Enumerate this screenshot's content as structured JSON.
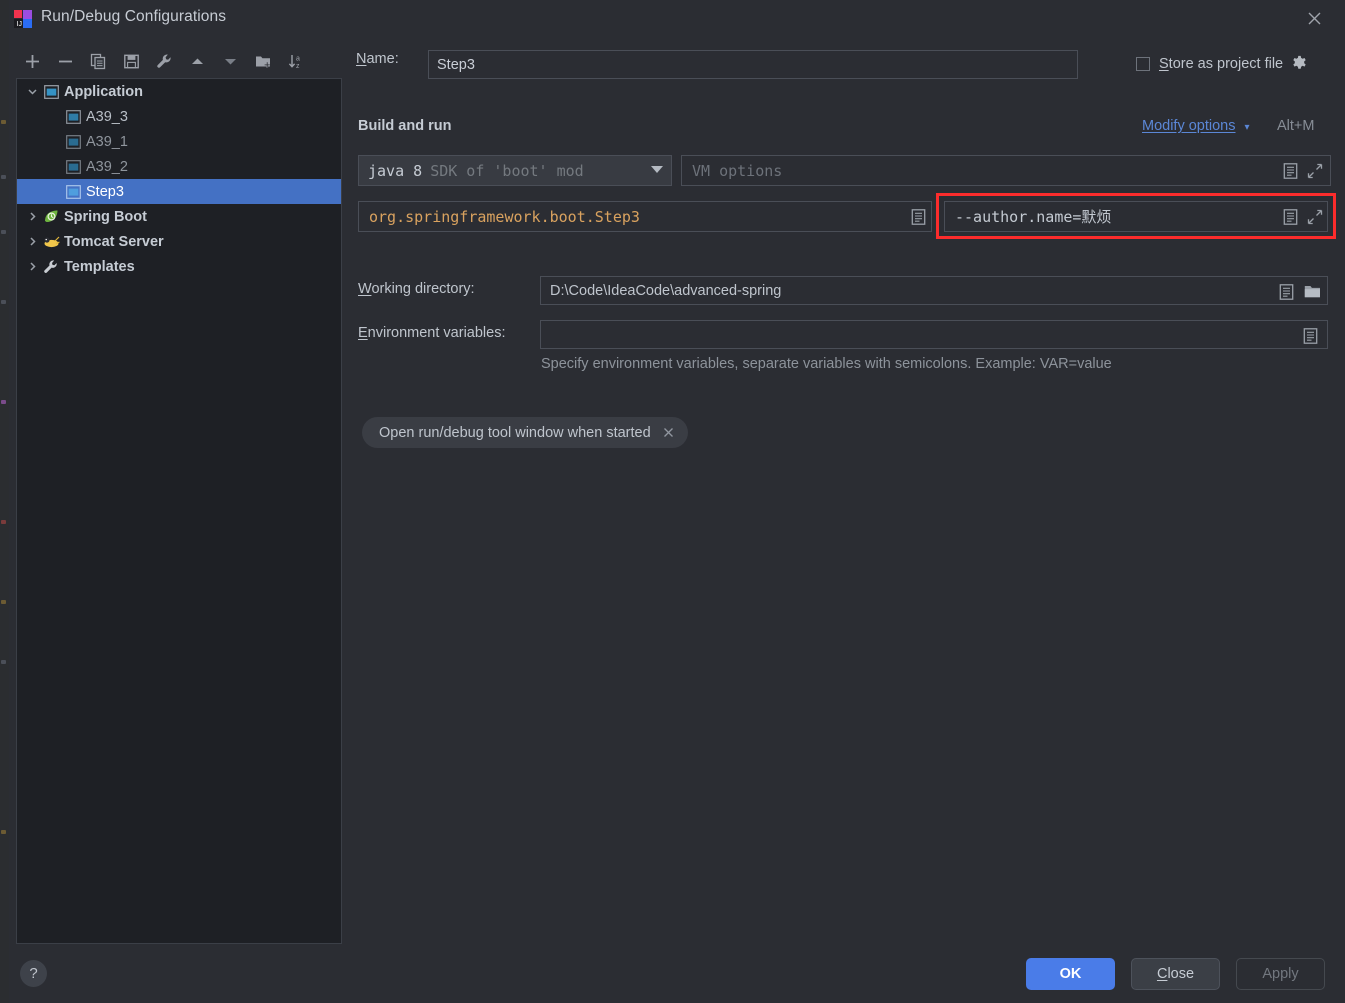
{
  "window": {
    "title": "Run/Debug Configurations",
    "logo_icon": "intellij-idea-logo",
    "close_icon": "close-icon"
  },
  "tree_toolbar": {
    "buttons": [
      {
        "name": "add-configuration-button",
        "icon": "plus-icon",
        "tooltip": "Add New Configuration"
      },
      {
        "name": "remove-configuration-button",
        "icon": "minus-icon",
        "tooltip": "Remove Configuration"
      },
      {
        "name": "copy-configuration-button",
        "icon": "copy-icon",
        "tooltip": "Copy Configuration"
      },
      {
        "name": "save-configuration-button",
        "icon": "save-icon",
        "tooltip": "Save Configuration"
      },
      {
        "name": "edit-templates-button",
        "icon": "wrench-icon",
        "tooltip": "Edit Templates"
      },
      {
        "name": "move-up-button",
        "icon": "arrow-up-icon",
        "tooltip": "Move Up"
      },
      {
        "name": "move-down-button",
        "icon": "arrow-down-icon",
        "tooltip": "Move Down"
      },
      {
        "name": "new-folder-button",
        "icon": "new-folder-icon",
        "tooltip": "Create New Folder"
      },
      {
        "name": "sort-alphabetically-button",
        "icon": "sort-alphabetically-icon",
        "tooltip": "Sort Configurations"
      }
    ]
  },
  "tree": {
    "items": [
      {
        "label": "Application",
        "icon": "application-icon",
        "expanded": true,
        "has_arrow": true,
        "bold": true,
        "indent": 0,
        "selected": false
      },
      {
        "label": "A39_3",
        "icon": "application-icon",
        "has_arrow": false,
        "bold": false,
        "indent": 1,
        "selected": false
      },
      {
        "label": "A39_1",
        "icon": "application-icon",
        "has_arrow": false,
        "bold": false,
        "indent": 1,
        "selected": false
      },
      {
        "label": "A39_2",
        "icon": "application-icon",
        "has_arrow": false,
        "bold": false,
        "indent": 1,
        "selected": false
      },
      {
        "label": "Step3",
        "icon": "application-icon",
        "has_arrow": false,
        "bold": false,
        "indent": 1,
        "selected": true
      },
      {
        "label": "Spring Boot",
        "icon": "spring-boot-icon",
        "expanded": false,
        "has_arrow": true,
        "bold": true,
        "indent": 0,
        "selected": false
      },
      {
        "label": "Tomcat Server",
        "icon": "tomcat-icon",
        "expanded": false,
        "has_arrow": true,
        "bold": true,
        "indent": 0,
        "selected": false
      },
      {
        "label": "Templates",
        "icon": "wrench-icon",
        "expanded": false,
        "has_arrow": true,
        "bold": true,
        "indent": 0,
        "selected": false
      }
    ]
  },
  "form": {
    "name_label": "Name:",
    "name_label_mnemonic": "N",
    "name_value": "Step3",
    "store_as_project_file_label": "Store as project file",
    "store_as_project_file_mnemonic": "S",
    "store_as_project_file_checked": false,
    "store_gear_icon": "gear-icon",
    "section_title": "Build and run",
    "modify_options_label": "Modify options",
    "modify_options_shortcut": "Alt+M",
    "modify_options_chevron_icon": "chevron-down-icon",
    "jdk_name": "java 8",
    "jdk_description": "SDK of 'boot' mod",
    "jdk_caret_icon": "dropdown-caret-icon",
    "vm_options_placeholder": "VM options",
    "main_class_value": "org.springframework.boot.Step3",
    "program_arguments_value": "--author.name=默烦",
    "macro_icon": "insert-macro-icon",
    "expand_icon": "expand-editor-icon",
    "browse_icon": "browse-folder-icon",
    "working_directory_label": "Working directory:",
    "working_directory_mnemonic": "W",
    "working_directory_value": "D:\\Code\\IdeaCode\\advanced-spring",
    "environment_variables_label": "Environment variables:",
    "environment_variables_mnemonic": "E",
    "environment_variables_value": "",
    "environment_variables_hint": "Specify environment variables, separate variables with semicolons. Example: VAR=value",
    "chip_label": "Open run/debug tool window when started",
    "chip_close_icon": "close-icon"
  },
  "footer": {
    "help_label": "?",
    "ok_label": "OK",
    "close_label": "Close",
    "close_mnemonic": "C",
    "apply_label": "Apply",
    "apply_enabled": false
  },
  "colors": {
    "dialog_bg": "#2b2d33",
    "tree_bg": "#1e2025",
    "selection_blue": "#4471c4",
    "accent_blue": "#4a7ce8",
    "link_blue": "#5b87d6",
    "highlight_red": "#fc2c2c",
    "main_class_orange": "#d9a25f",
    "text_primary": "#bfc5cd",
    "text_muted": "#8d939b"
  }
}
